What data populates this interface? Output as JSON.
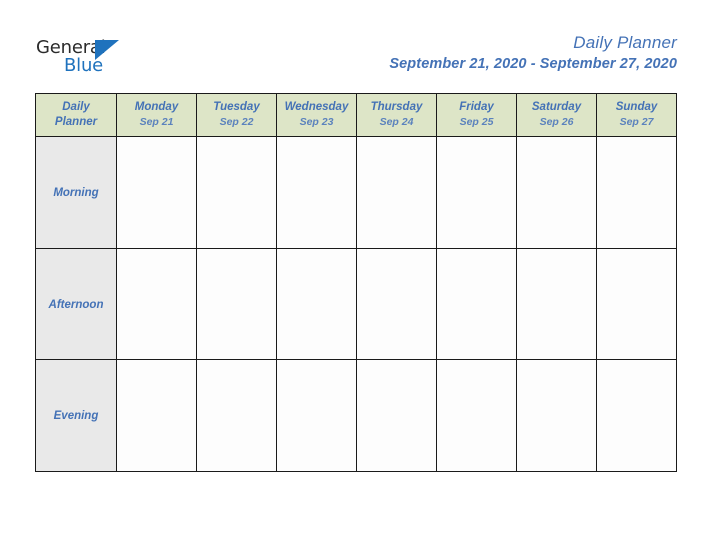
{
  "brand": {
    "name_part1": "General",
    "name_part2": "Blue",
    "flag_icon": "blue-flag-triangle",
    "color_dark": "#2b2b2b",
    "color_blue": "#1f72bd"
  },
  "header": {
    "title": "Daily Planner",
    "subtitle": "September 21, 2020 - September 27, 2020",
    "accent_color": "#4472b6"
  },
  "table": {
    "corner": {
      "line1": "Daily",
      "line2": "Planner"
    },
    "header_bg": "#dde5c7",
    "row_label_bg": "#e9e9e9",
    "cell_bg": "#fdfdfd",
    "border_color": "#1a1a1a",
    "days": [
      {
        "name": "Monday",
        "date": "Sep 21"
      },
      {
        "name": "Tuesday",
        "date": "Sep 22"
      },
      {
        "name": "Wednesday",
        "date": "Sep 23"
      },
      {
        "name": "Thursday",
        "date": "Sep 24"
      },
      {
        "name": "Friday",
        "date": "Sep 25"
      },
      {
        "name": "Saturday",
        "date": "Sep 26"
      },
      {
        "name": "Sunday",
        "date": "Sep 27"
      }
    ],
    "time_slots": [
      {
        "label": "Morning",
        "entries": [
          "",
          "",
          "",
          "",
          "",
          "",
          ""
        ]
      },
      {
        "label": "Afternoon",
        "entries": [
          "",
          "",
          "",
          "",
          "",
          "",
          ""
        ]
      },
      {
        "label": "Evening",
        "entries": [
          "",
          "",
          "",
          "",
          "",
          "",
          ""
        ]
      }
    ]
  }
}
